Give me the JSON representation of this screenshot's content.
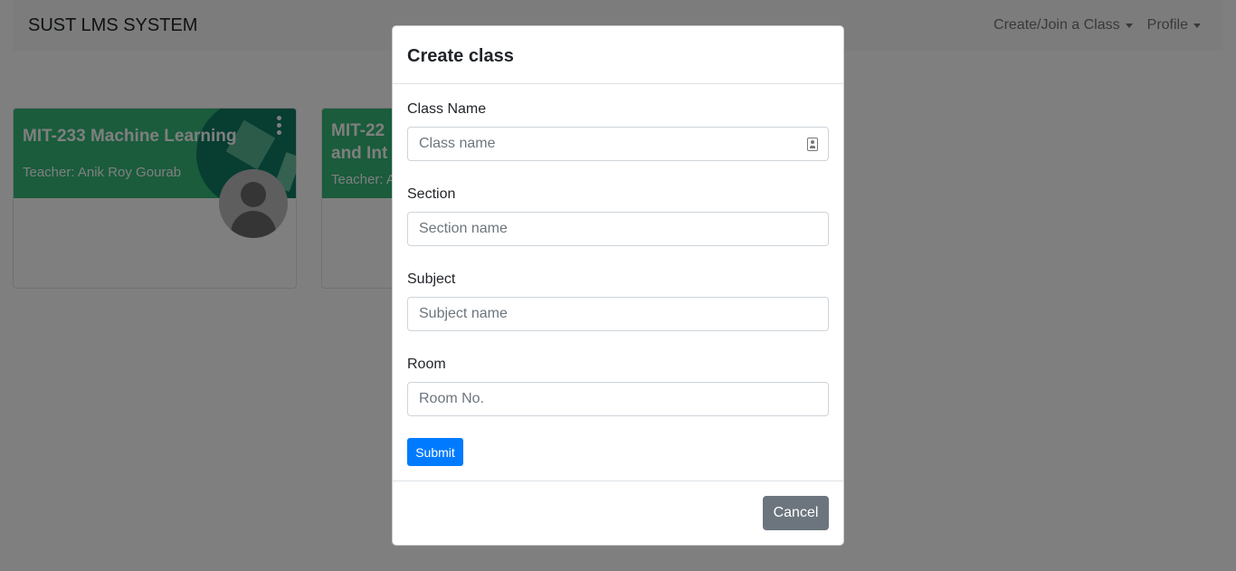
{
  "navbar": {
    "brand": "SUST LMS SYSTEM",
    "links": [
      {
        "label": "Create/Join a Class"
      },
      {
        "label": "Profile"
      }
    ]
  },
  "classes": [
    {
      "title": "MIT-233 Machine Learning",
      "teacher": "Teacher: Anik Roy Gourab"
    },
    {
      "title": "MIT-22",
      "title_line2": "and Int",
      "teacher": "Teacher: A"
    }
  ],
  "modal": {
    "title": "Create class",
    "fields": [
      {
        "label": "Class Name",
        "placeholder": "Class name",
        "value": ""
      },
      {
        "label": "Section",
        "placeholder": "Section name",
        "value": ""
      },
      {
        "label": "Subject",
        "placeholder": "Subject name",
        "value": ""
      },
      {
        "label": "Room",
        "placeholder": "Room No.",
        "value": ""
      }
    ],
    "submit_label": "Submit",
    "cancel_label": "Cancel"
  },
  "colors": {
    "card_header": "#34b878",
    "primary": "#007bff",
    "secondary": "#6c757d",
    "backdrop": "rgba(0,0,0,0.5)"
  }
}
